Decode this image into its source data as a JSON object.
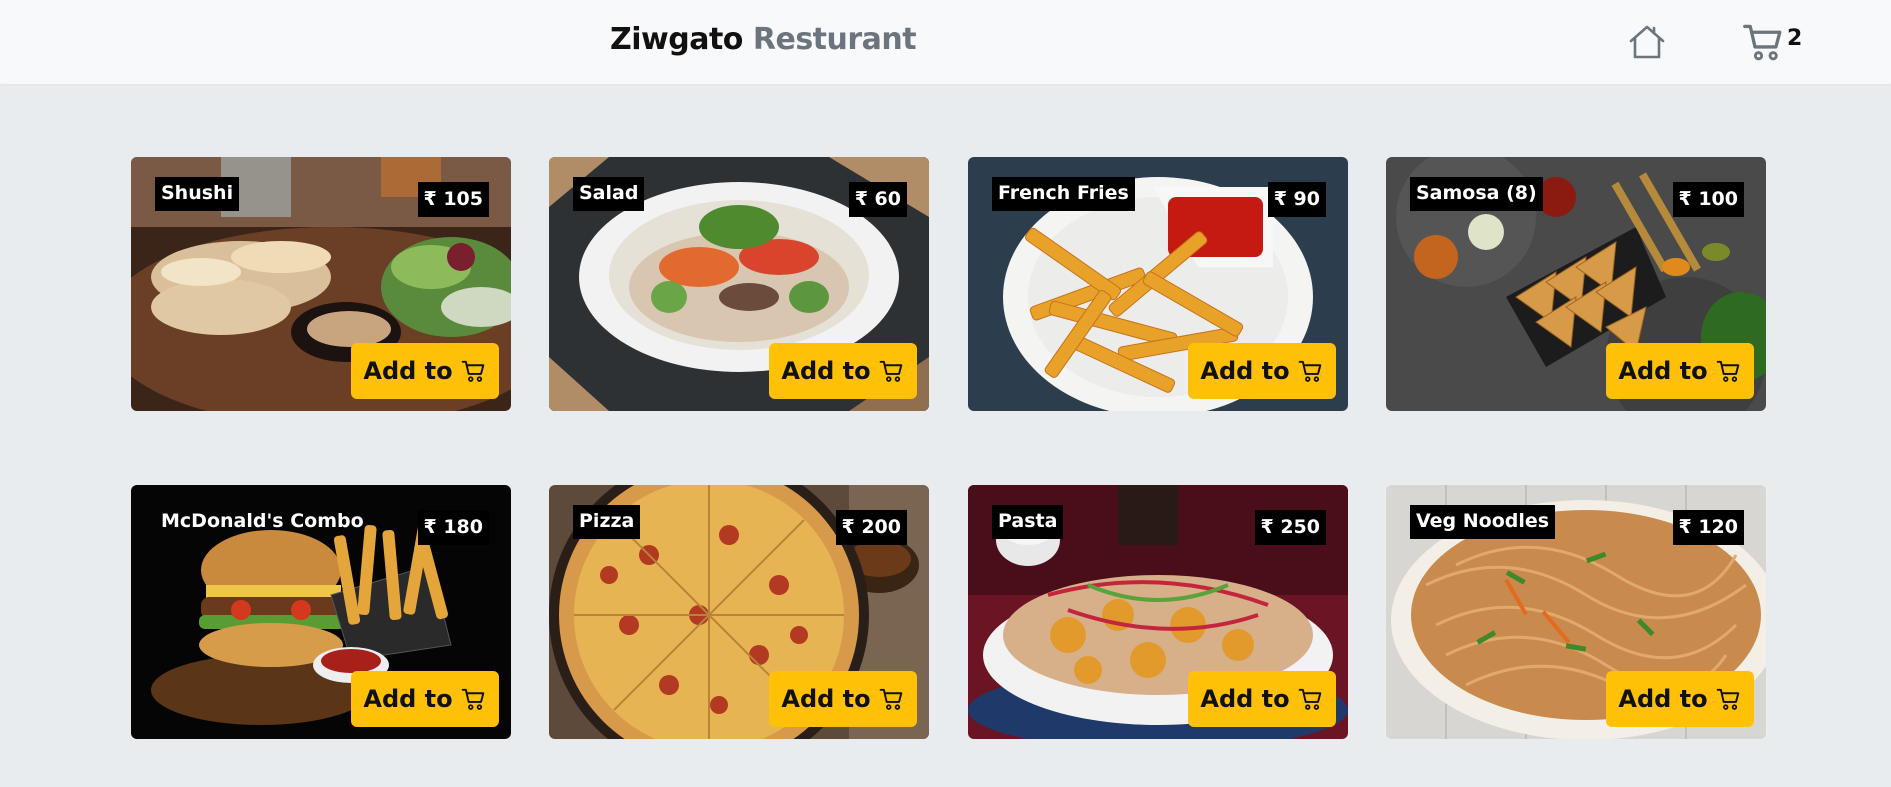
{
  "brand": {
    "name": "Ziwgato",
    "accent": "Resturant"
  },
  "nav": {
    "cart_count": "2"
  },
  "colors": {
    "accent": "#ffc107",
    "tag_bg": "#000000",
    "page_bg": "#e9ecef",
    "nav_bg": "#f8f9fa"
  },
  "icons": {
    "home": "home-icon",
    "cart": "cart-icon"
  },
  "add_label": "Add to",
  "products": [
    {
      "name": "Shushi",
      "price": "₹ 105"
    },
    {
      "name": "Salad",
      "price": "₹ 60"
    },
    {
      "name": "French Fries",
      "price": "₹ 90"
    },
    {
      "name": "Samosa (8)",
      "price": "₹ 100"
    },
    {
      "name": "McDonald's Combo",
      "price": "₹ 180"
    },
    {
      "name": "Pizza",
      "price": "₹ 200"
    },
    {
      "name": "Pasta",
      "price": "₹ 250"
    },
    {
      "name": "Veg Noodles",
      "price": "₹ 120"
    }
  ]
}
